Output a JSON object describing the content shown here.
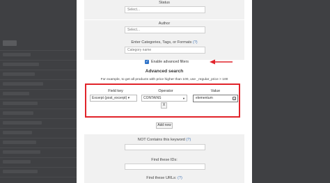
{
  "filters": {
    "status": {
      "label": "Status",
      "placeholder": "Select..."
    },
    "author": {
      "label": "Author",
      "placeholder": "Select..."
    },
    "categories": {
      "label": "Enter Categories, Tags, or Formats",
      "help": "(?)",
      "placeholder": "Category name"
    },
    "not_contains": {
      "label": "NOT Contains this keyword",
      "help": "(?)"
    },
    "find_ids": {
      "label": "Find these IDs:"
    },
    "find_urls": {
      "label": "Find these URLs:",
      "help": "(?)"
    }
  },
  "advanced_toggle": {
    "label": "Enable advanced filters",
    "checked": true
  },
  "advanced_search": {
    "heading": "Advanced search",
    "example": "For example, to get all products with price higher than 100, use _regular_price > 100",
    "columns": {
      "field_key": "Field key",
      "operator": "Operator",
      "value": "Value"
    },
    "row": {
      "field_key": "Excerpt (post_excerpt) ▾",
      "operator": "CONTAINS",
      "value": "elementum",
      "remove_label": "X"
    },
    "add_new_label": "Add new"
  },
  "colors": {
    "highlight": "#e1232a",
    "checkbox": "#2f73c8",
    "link": "#4a7ab8"
  }
}
